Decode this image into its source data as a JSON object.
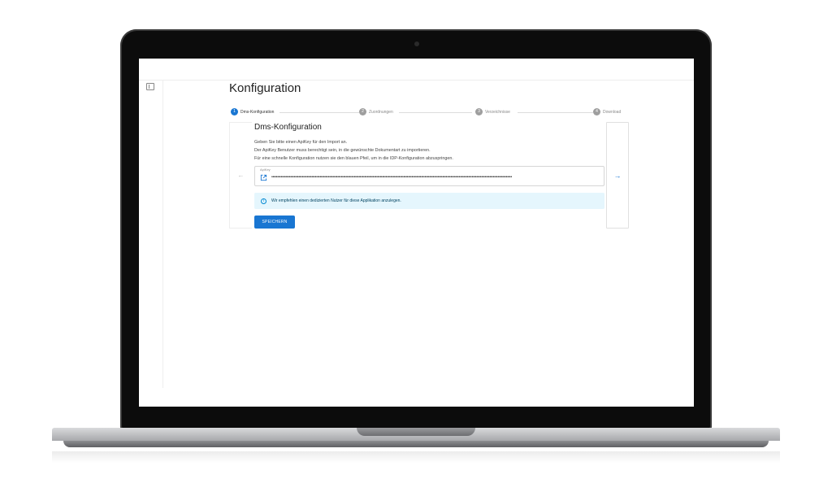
{
  "sidebar": {
    "toggle_icon": "sidebar-toggle-icon"
  },
  "page": {
    "title": "Konfiguration"
  },
  "stepper": {
    "steps": [
      {
        "number": "1",
        "label": "Dms-Konfiguration",
        "active": true
      },
      {
        "number": "2",
        "label": "Zuordnungen",
        "active": false
      },
      {
        "number": "3",
        "label": "Verzeichnisse",
        "active": false
      },
      {
        "number": "4",
        "label": "Download",
        "active": false
      }
    ]
  },
  "card": {
    "title": "Dms-Konfiguration",
    "description": [
      "Geben Sie bitte einen ApiKey für den Import an.",
      "Der ApiKey Benutzer muss berechtigt sein, in die gewünschte Dokumentart zu importieren.",
      "Für eine schnelle Konfiguration nutzen sie den blauen Pfeil, um in die IDP-Konfiguration abzuspringen."
    ],
    "apikey_field": {
      "label": "ApiKey",
      "value": "••••••••••••••••••••••••••••••••••••••••••••••••••••••••••••••••••••••••••••••••••••••••••••••••••••••••••••••••••••••••••••••••••••••••••••••••••••••••••••••••••••••••••••••••••••••••••••••••••••••••••••"
    },
    "info_alert": "Wir empfehlen einen dedizierten Nutzer für diese Applikation anzulegen.",
    "save_label": "SPEICHERN",
    "prev_arrow": "←",
    "next_arrow": "→"
  },
  "colors": {
    "primary": "#1976d2",
    "info_bg": "#e5f6fd",
    "info_text": "#014361",
    "inactive_step": "#9e9e9e"
  }
}
